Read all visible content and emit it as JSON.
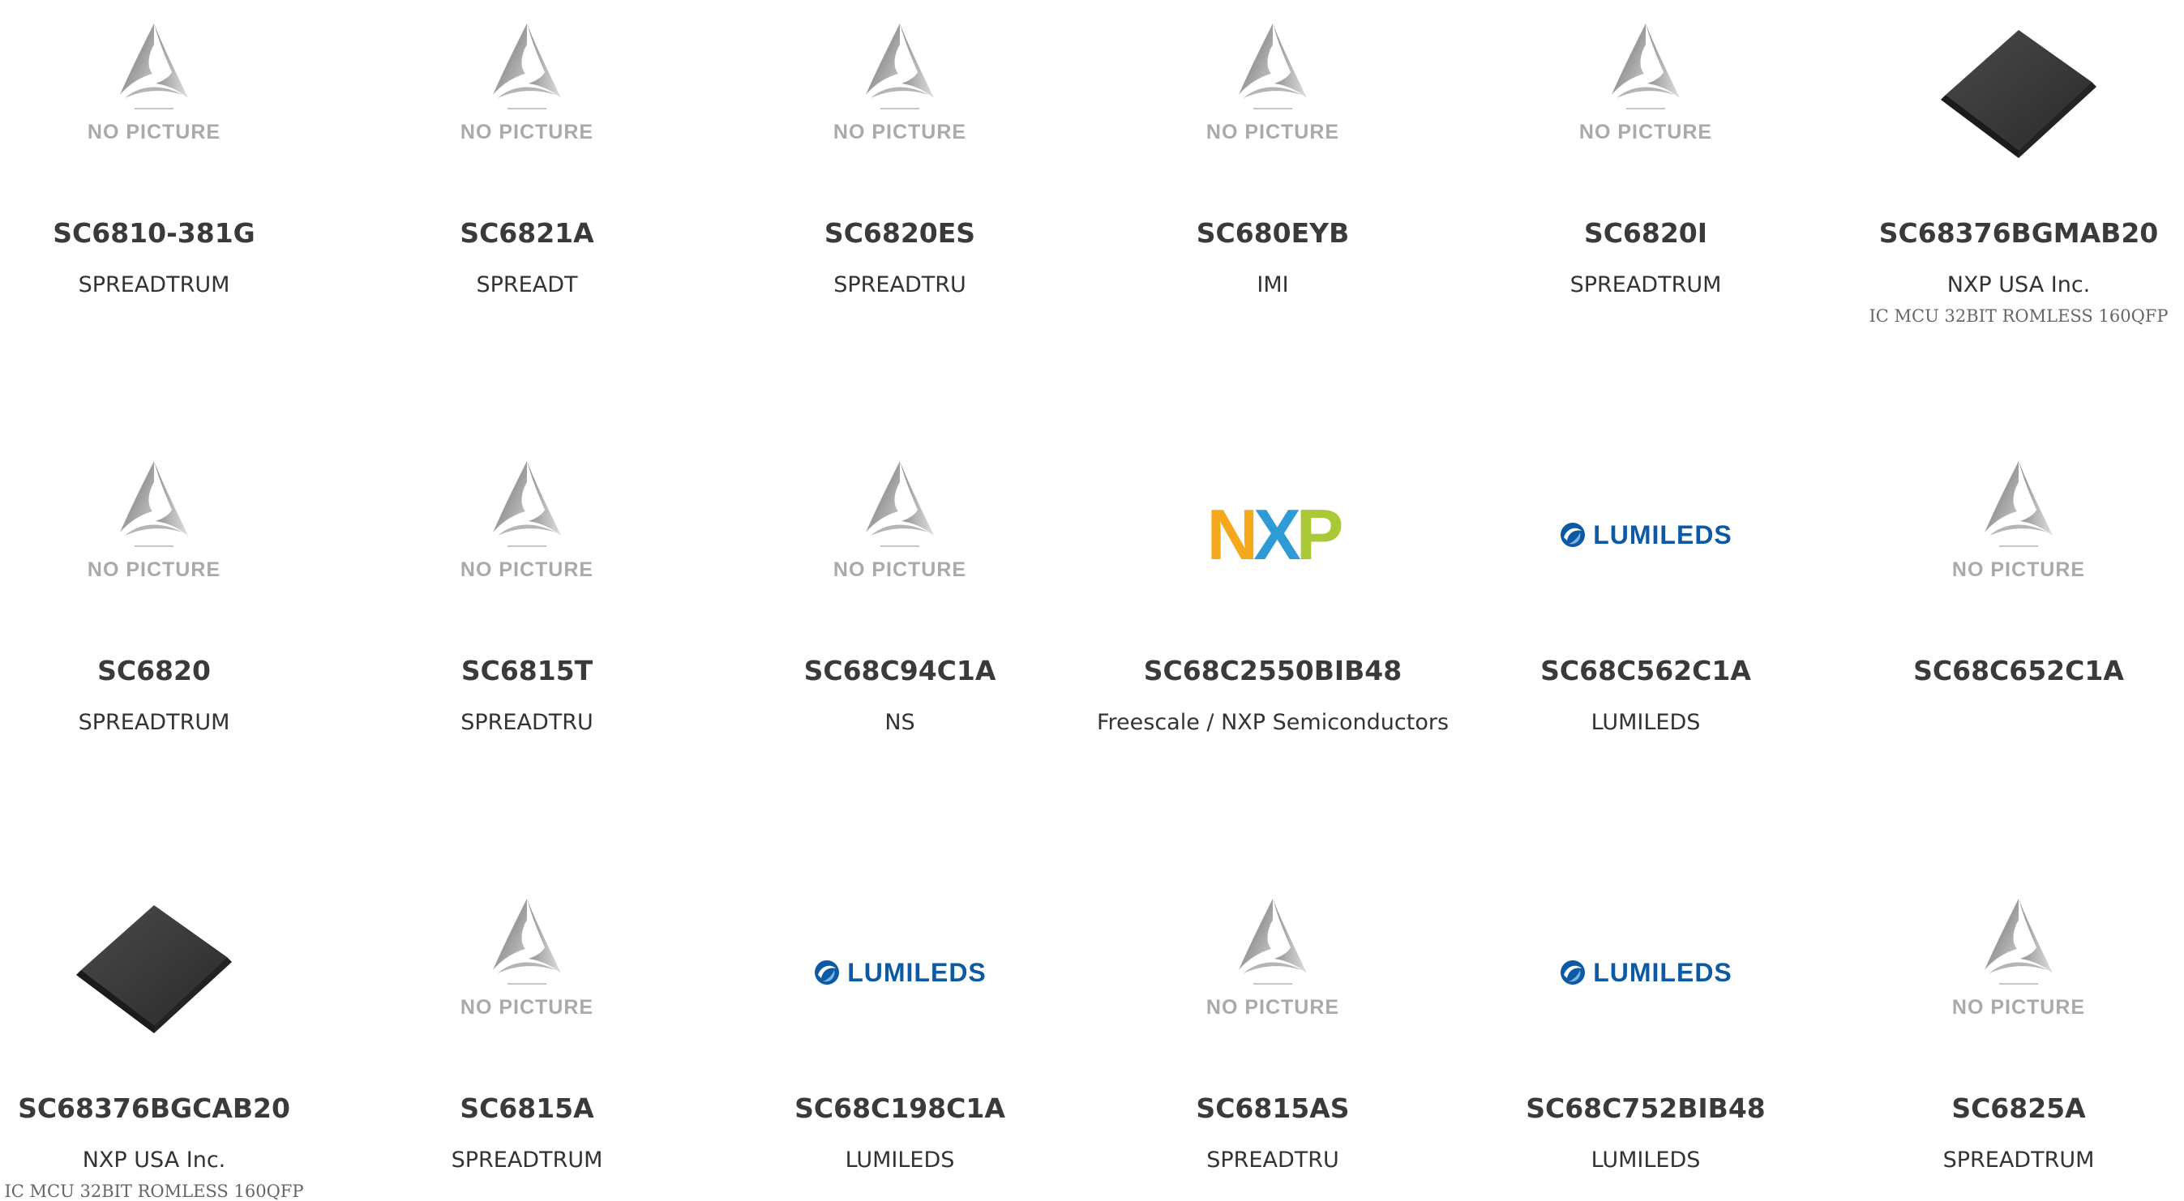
{
  "products": [
    {
      "part": "SC6810-381G",
      "mfr": "SPREADTRUM",
      "desc": "",
      "image": "no-picture"
    },
    {
      "part": "SC6821A",
      "mfr": "SPREADT",
      "desc": "",
      "image": "no-picture"
    },
    {
      "part": "SC6820ES",
      "mfr": "SPREADTRU",
      "desc": "",
      "image": "no-picture"
    },
    {
      "part": "SC680EYB",
      "mfr": "IMI",
      "desc": "",
      "image": "no-picture"
    },
    {
      "part": "SC6820I",
      "mfr": "SPREADTRUM",
      "desc": "",
      "image": "no-picture"
    },
    {
      "part": "SC68376BGMAB20",
      "mfr": "NXP USA Inc.",
      "desc": "IC MCU 32BIT ROMLESS 160QFP",
      "image": "chip"
    },
    {
      "part": "SC6820",
      "mfr": "SPREADTRUM",
      "desc": "",
      "image": "no-picture"
    },
    {
      "part": "SC6815T",
      "mfr": "SPREADTRU",
      "desc": "",
      "image": "no-picture"
    },
    {
      "part": "SC68C94C1A",
      "mfr": "NS",
      "desc": "",
      "image": "no-picture"
    },
    {
      "part": "SC68C2550BIB48",
      "mfr": "Freescale / NXP Semiconductors",
      "desc": "",
      "image": "nxp-logo"
    },
    {
      "part": "SC68C562C1A",
      "mfr": "LUMILEDS",
      "desc": "",
      "image": "lumileds-logo"
    },
    {
      "part": "SC68C652C1A",
      "mfr": "",
      "desc": "",
      "image": "no-picture"
    },
    {
      "part": "SC68376BGCAB20",
      "mfr": "NXP USA Inc.",
      "desc": "IC MCU 32BIT ROMLESS 160QFP",
      "image": "chip"
    },
    {
      "part": "SC6815A",
      "mfr": "SPREADTRUM",
      "desc": "",
      "image": "no-picture"
    },
    {
      "part": "SC68C198C1A",
      "mfr": "LUMILEDS",
      "desc": "",
      "image": "lumileds-logo"
    },
    {
      "part": "SC6815AS",
      "mfr": "SPREADTRU",
      "desc": "",
      "image": "no-picture"
    },
    {
      "part": "SC68C752BIB48",
      "mfr": "LUMILEDS",
      "desc": "",
      "image": "lumileds-logo"
    },
    {
      "part": "SC6825A",
      "mfr": "SPREADTRUM",
      "desc": "",
      "image": "no-picture"
    }
  ],
  "placeholder_text": "NO PICTURE",
  "nxp_letters": [
    "N",
    "X",
    "P"
  ],
  "lumileds_text": "LUMILEDS",
  "colors": {
    "nxp_n": "#f5a81c",
    "nxp_x": "#2f9bd6",
    "nxp_p": "#a9c937",
    "lumileds": "#0c5aa6",
    "placeholder": "#aaaaaa"
  }
}
